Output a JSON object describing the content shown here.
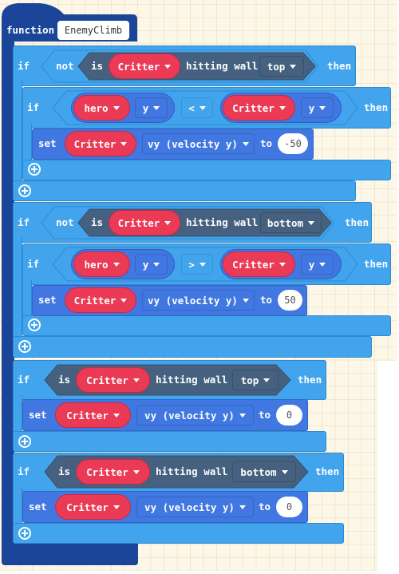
{
  "function_block": {
    "keyword": "function",
    "name": "EnemyClimb"
  },
  "blocks": [
    {
      "if_label": "if",
      "not_label": "not",
      "is_label": "is",
      "sprite": "Critter",
      "hitting_wall_label": "hitting wall",
      "wall": "top",
      "then_label": "then",
      "inner_if": {
        "if_label": "if",
        "left_sprite": "hero",
        "left_prop": "y",
        "operator": "<",
        "right_sprite": "Critter",
        "right_prop": "y",
        "then_label": "then",
        "set": {
          "set_label": "set",
          "sprite": "Critter",
          "property": "vy (velocity y)",
          "to_label": "to",
          "value": "-50"
        }
      }
    },
    {
      "if_label": "if",
      "not_label": "not",
      "is_label": "is",
      "sprite": "Critter",
      "hitting_wall_label": "hitting wall",
      "wall": "bottom",
      "then_label": "then",
      "inner_if": {
        "if_label": "if",
        "left_sprite": "hero",
        "left_prop": "y",
        "operator": ">",
        "right_sprite": "Critter",
        "right_prop": "y",
        "then_label": "then",
        "set": {
          "set_label": "set",
          "sprite": "Critter",
          "property": "vy (velocity y)",
          "to_label": "to",
          "value": "50"
        }
      }
    },
    {
      "if_label": "if",
      "is_label": "is",
      "sprite": "Critter",
      "hitting_wall_label": "hitting wall",
      "wall": "top",
      "then_label": "then",
      "set": {
        "set_label": "set",
        "sprite": "Critter",
        "property": "vy (velocity y)",
        "to_label": "to",
        "value": "0"
      }
    },
    {
      "if_label": "if",
      "is_label": "is",
      "sprite": "Critter",
      "hitting_wall_label": "hitting wall",
      "wall": "bottom",
      "then_label": "then",
      "set": {
        "set_label": "set",
        "sprite": "Critter",
        "property": "vy (velocity y)",
        "to_label": "to",
        "value": "0"
      }
    }
  ],
  "colors": {
    "function_block": "#1b4598",
    "logic_block": "#42a4ec",
    "sprite_block": "#4177e0",
    "sprite_pill": "#ea3a56",
    "condition_dark": "#46617f",
    "workspace": "#fdf7e7"
  }
}
